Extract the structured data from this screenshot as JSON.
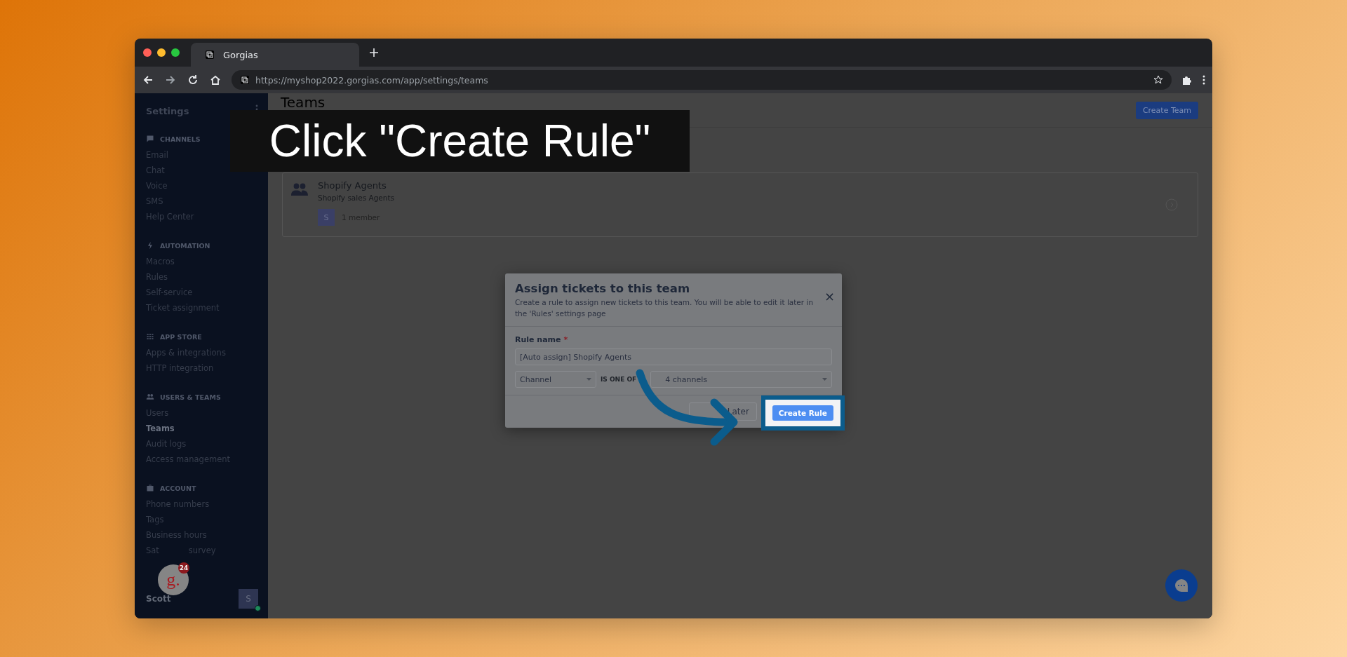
{
  "browser": {
    "tab_title": "Gorgias",
    "url": "https://myshop2022.gorgias.com/app/settings/teams"
  },
  "sidebar": {
    "title": "Settings",
    "sections": [
      {
        "kind": "chat",
        "heading": "CHANNELS",
        "items": [
          {
            "label": "Email",
            "selected": false
          },
          {
            "label": "Chat",
            "selected": false
          },
          {
            "label": "Voice",
            "selected": false
          },
          {
            "label": "SMS",
            "selected": false
          },
          {
            "label": "Help Center",
            "selected": false
          }
        ]
      },
      {
        "kind": "bolt",
        "heading": "AUTOMATION",
        "items": [
          {
            "label": "Macros",
            "selected": false
          },
          {
            "label": "Rules",
            "selected": false
          },
          {
            "label": "Self-service",
            "selected": false
          },
          {
            "label": "Ticket assignment",
            "selected": false
          }
        ]
      },
      {
        "kind": "grid",
        "heading": "APP STORE",
        "items": [
          {
            "label": "Apps & integrations",
            "selected": false
          },
          {
            "label": "HTTP integration",
            "selected": false
          }
        ]
      },
      {
        "kind": "people",
        "heading": "USERS & TEAMS",
        "items": [
          {
            "label": "Users",
            "selected": false
          },
          {
            "label": "Teams",
            "selected": true
          },
          {
            "label": "Audit logs",
            "selected": false
          },
          {
            "label": "Access management",
            "selected": false
          }
        ]
      },
      {
        "kind": "briefcase",
        "heading": "ACCOUNT",
        "items": [
          {
            "label": "Phone numbers",
            "selected": false
          },
          {
            "label": "Tags",
            "selected": false
          },
          {
            "label": "Business hours",
            "selected": false
          },
          {
            "label": "Sat",
            "selected": false,
            "tail": "survey"
          }
        ]
      }
    ],
    "user": {
      "name": "Scott",
      "initial": "S",
      "online": true
    },
    "launcher": {
      "logo": "g.",
      "badge": "24"
    }
  },
  "page": {
    "title": "Teams",
    "create_button": "Create Team",
    "teams": [
      {
        "name": "Shopify Agents",
        "description": "Shopify sales Agents",
        "avatar": "S",
        "members": "1 member"
      }
    ]
  },
  "modal": {
    "title": "Assign tickets to this team",
    "description": "Create a rule to assign new tickets to this team. You will be able to edit it later in the 'Rules' settings page",
    "close": "×",
    "field_label": "Rule name",
    "required_mark": "*",
    "field_value": "[Auto assign] Shopify Agents",
    "condition": {
      "field": "Channel",
      "operator": "IS ONE OF",
      "value": "4 channels"
    },
    "secondary_button": "Later",
    "primary_button": "Create Rule",
    "primary_highlighted": true
  },
  "caption": "Click \"Create Rule\""
}
